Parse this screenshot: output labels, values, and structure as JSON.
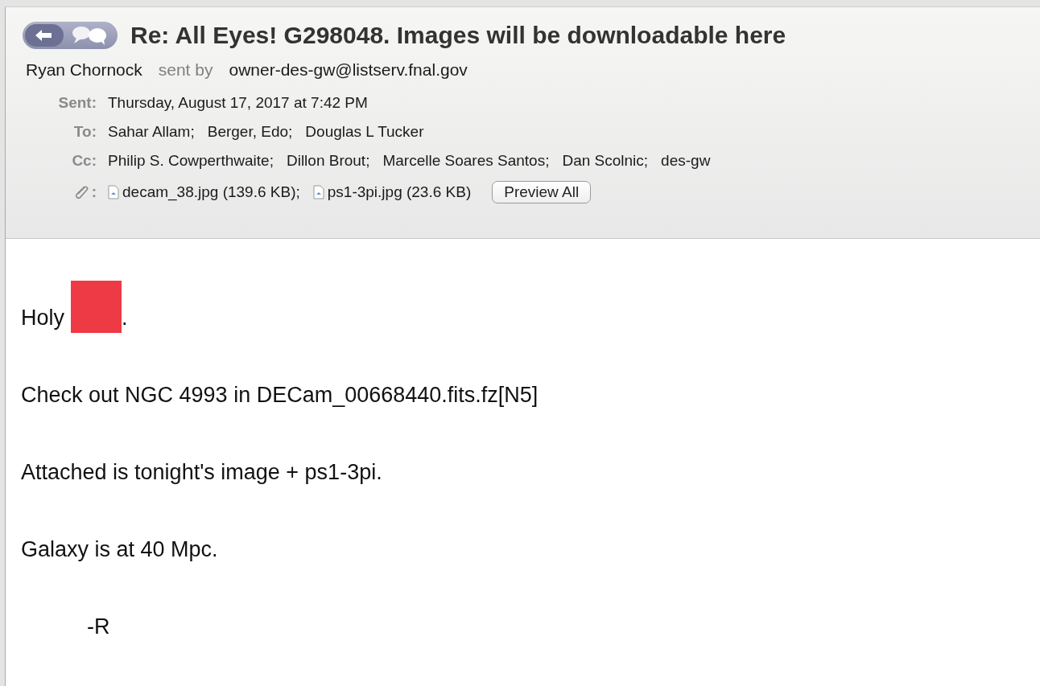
{
  "message": {
    "title": "Re: All Eyes! G298048. Images will be downloadable here",
    "sender": "Ryan Chornock",
    "sent_by_label": "sent by",
    "sender_address": "owner-des-gw@listserv.fnal.gov",
    "fields": [
      {
        "kind": "text",
        "label": "Sent:",
        "values": [
          "Thursday, August 17, 2017 at 7:42 PM"
        ]
      },
      {
        "kind": "text",
        "label": "To:",
        "values": [
          "Sahar Allam;",
          "Berger, Edo;",
          "Douglas L Tucker"
        ]
      },
      {
        "kind": "text",
        "label": "Cc:",
        "values": [
          "Philip S. Cowperthwaite;",
          "Dillon Brout;",
          "Marcelle Soares Santos;",
          "Dan Scolnic;",
          "des-gw"
        ]
      },
      {
        "kind": "attachments",
        "label": ":",
        "values": [
          "decam_38.jpg (139.6 KB);",
          "ps1-3pi.jpg (23.6 KB)"
        ],
        "button": "Preview All"
      }
    ]
  },
  "body": {
    "paragraphs": [
      {
        "kind": "redacted",
        "before": "Holy",
        "after": "."
      },
      {
        "kind": "text",
        "text": "Check out NGC 4993 in DECam_00668440.fits.fz[N5]"
      },
      {
        "kind": "text",
        "text": "Attached is tonight's image + ps1-3pi."
      },
      {
        "kind": "text",
        "text": "Galaxy is at 40 Mpc."
      },
      {
        "kind": "signature",
        "text": "-R"
      }
    ]
  }
}
